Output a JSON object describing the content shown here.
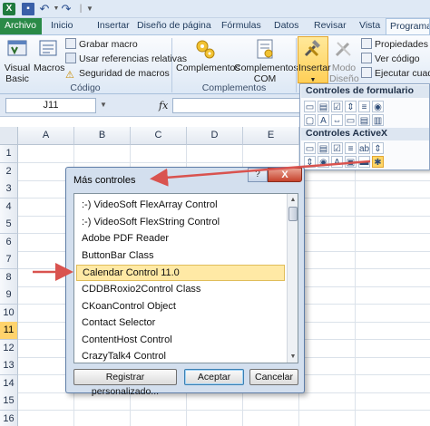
{
  "quick_access": {
    "logo": "X",
    "more": "▼"
  },
  "tabs": [
    "Archivo",
    "Inicio",
    "Insertar",
    "Diseño de página",
    "Fórmulas",
    "Datos",
    "Revisar",
    "Vista",
    "Programador"
  ],
  "ribbon": {
    "visual_basic": "Visual\nBasic",
    "macros": "Macros",
    "grabar_macro": "Grabar macro",
    "usar_referencias": "Usar referencias relativas",
    "seguridad_macros": "Seguridad de macros",
    "group_codigo": "Código",
    "complementos": "Complementos",
    "complementos_com": "Complementos\nCOM",
    "group_complementos": "Complementos",
    "insertar": "Insertar",
    "modo_diseno": "Modo\nDiseño",
    "propiedades": "Propiedades",
    "ver_codigo": "Ver código",
    "ejecutar_cuadro": "Ejecutar cuadro"
  },
  "formula_bar": {
    "name_box": "J11",
    "fx": "fx",
    "value": ""
  },
  "grid": {
    "columns": [
      "A",
      "B",
      "C",
      "D",
      "E"
    ],
    "rows": [
      "1",
      "2",
      "3",
      "4",
      "5",
      "6",
      "7",
      "8",
      "9",
      "10",
      "11",
      "12",
      "13",
      "14",
      "15",
      "16"
    ],
    "selected_row": "11"
  },
  "controls_popup": {
    "form_controls_title": "Controles de formulario",
    "activex_title": "Controles ActiveX"
  },
  "dialog": {
    "title": "Más controles",
    "help": "?",
    "close": "X",
    "items": [
      ":-) VideoSoft FlexArray Control",
      ":-) VideoSoft FlexString Control",
      "Adobe PDF Reader",
      "ButtonBar Class",
      "Calendar Control 11.0",
      "CDDBRoxio2Control Class",
      "CKoanControl Object",
      "Contact Selector",
      "ContentHost Control",
      "CrazyTalk4 Control"
    ],
    "selected_index": 4,
    "register_button": "Registrar personalizado...",
    "ok_button": "Aceptar",
    "cancel_button": "Cancelar"
  },
  "colors": {
    "accent_red": "#d9534f",
    "selection": "#ffe9a5",
    "excel_green": "#2a8a47"
  }
}
